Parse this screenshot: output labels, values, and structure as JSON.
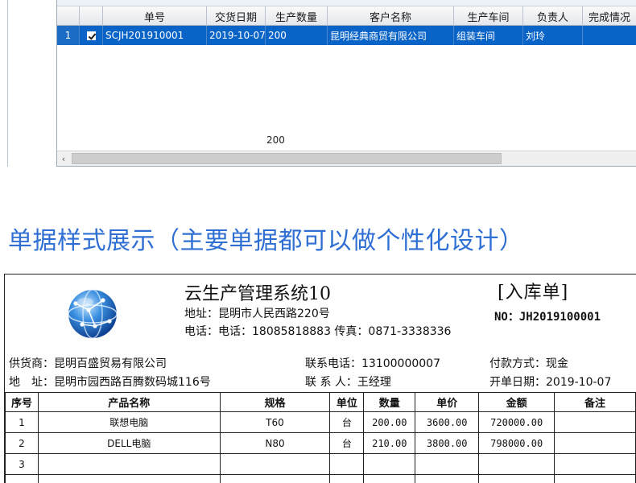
{
  "grid": {
    "columns": [
      "",
      "",
      "单号",
      "交货日期",
      "生产数量",
      "客户名称",
      "生产车间",
      "负责人",
      "完成情况"
    ],
    "row": {
      "index": "1",
      "order_no": "SCJH201910001",
      "delivery_date": "2019-10-07",
      "quantity": "200",
      "customer": "昆明经典商贸有限公司",
      "workshop": "组装车间",
      "manager": "刘玲",
      "status": ""
    },
    "total_quantity": "200",
    "scroll_left_glyph": "‹"
  },
  "headline": "单据样式展示（主要单据都可以做个性化设计）",
  "document": {
    "company": "云生产管理系统10",
    "type": "[入库单]",
    "address": "地址：昆明市人民西路220号",
    "contact": "电话：电话：18085818883 传真：0871-3338336",
    "number": "NO：JH2019100001",
    "supplier": "供货商：昆明百盛贸易有限公司",
    "supplier_phone": "联系电话：13100000007",
    "payment": "付款方式：现金",
    "supplier_address": "地　址：昆明市园西路百腾数码城116号",
    "contact_person": "联 系 人：王经理",
    "open_date": "开单日期：2019-10-07",
    "table": {
      "headers": [
        "序号",
        "产品名称",
        "规格",
        "单位",
        "数量",
        "单价",
        "金额",
        "备注"
      ],
      "rows": [
        [
          "1",
          "联想电脑",
          "T60",
          "台",
          "200.00",
          "3600.00",
          "720000.00",
          ""
        ],
        [
          "2",
          "DELL电脑",
          "N80",
          "台",
          "210.00",
          "3800.00",
          "798000.00",
          ""
        ],
        [
          "3",
          "",
          "",
          "",
          "",
          "",
          "",
          ""
        ],
        [
          "",
          "",
          "",
          "",
          "",
          "",
          "",
          ""
        ]
      ]
    }
  },
  "colors": {
    "selection": "#0a64c8",
    "headline": "#2f6fd3"
  },
  "icons": {
    "logo": "globe-network-icon",
    "checkbox": "checked-checkbox-icon"
  }
}
